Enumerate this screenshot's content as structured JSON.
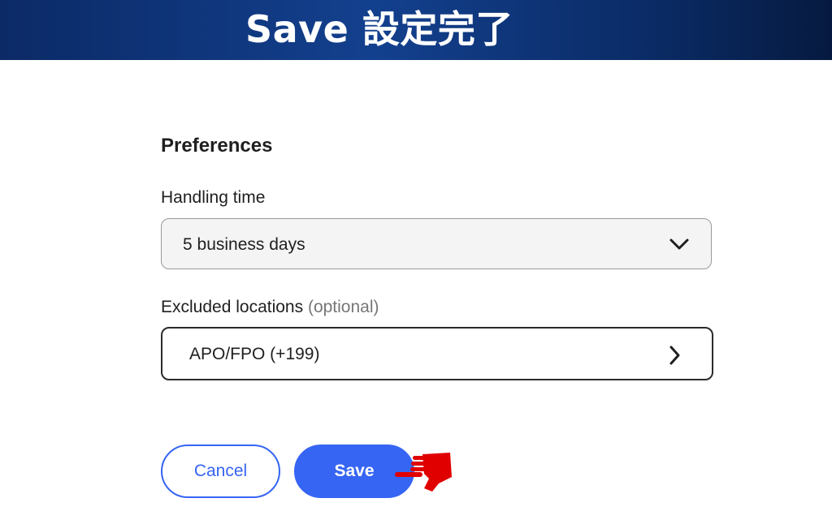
{
  "banner": {
    "title": "Save 設定完了"
  },
  "preferences": {
    "section_title": "Preferences",
    "handling_time": {
      "label": "Handling time",
      "selected": "5 business days"
    },
    "excluded_locations": {
      "label": "Excluded locations",
      "optional_label": "(optional)",
      "value": "APO/FPO (+199)"
    }
  },
  "actions": {
    "cancel_label": "Cancel",
    "save_label": "Save"
  },
  "colors": {
    "banner": "#13408e",
    "accent": "#3665f3",
    "pointer_hand": "#e00000"
  },
  "icons": [
    "chevron-down-icon",
    "chevron-right-icon",
    "pointing-hand-icon"
  ]
}
